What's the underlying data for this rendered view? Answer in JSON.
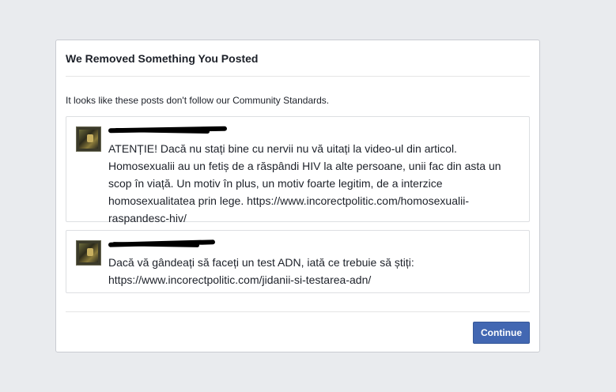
{
  "dialog": {
    "title": "We Removed Something You Posted",
    "intro": "It looks like these posts don't follow our Community Standards.",
    "continue_label": "Continue"
  },
  "posts": [
    {
      "author": "[redacted]",
      "text": "ATENȚIE! Dacă nu stați bine cu nervii nu vă uitați la video-ul din articol.\nHomosexualii au un fetiș de a răspândi HIV la alte persoane, unii fac din asta un\nscop în viață. Un motiv în plus, un motiv foarte legitim, de a interzice\nhomosexualitatea prin lege. https://www.incorectpolitic.com/homosexualii-\nraspandesc-hiv/"
    },
    {
      "author": "[redacted]",
      "text": "Dacă vă gândeați să faceți un test ADN, iată ce trebuie să știți:\nhttps://www.incorectpolitic.com/jidanii-si-testarea-adn/"
    }
  ],
  "colors": {
    "page_bg": "#e9ebee",
    "button_bg": "#4267b2",
    "text": "#1d2129"
  },
  "icons": {
    "post_thumbnail": "profile-thumbnail-icon"
  }
}
